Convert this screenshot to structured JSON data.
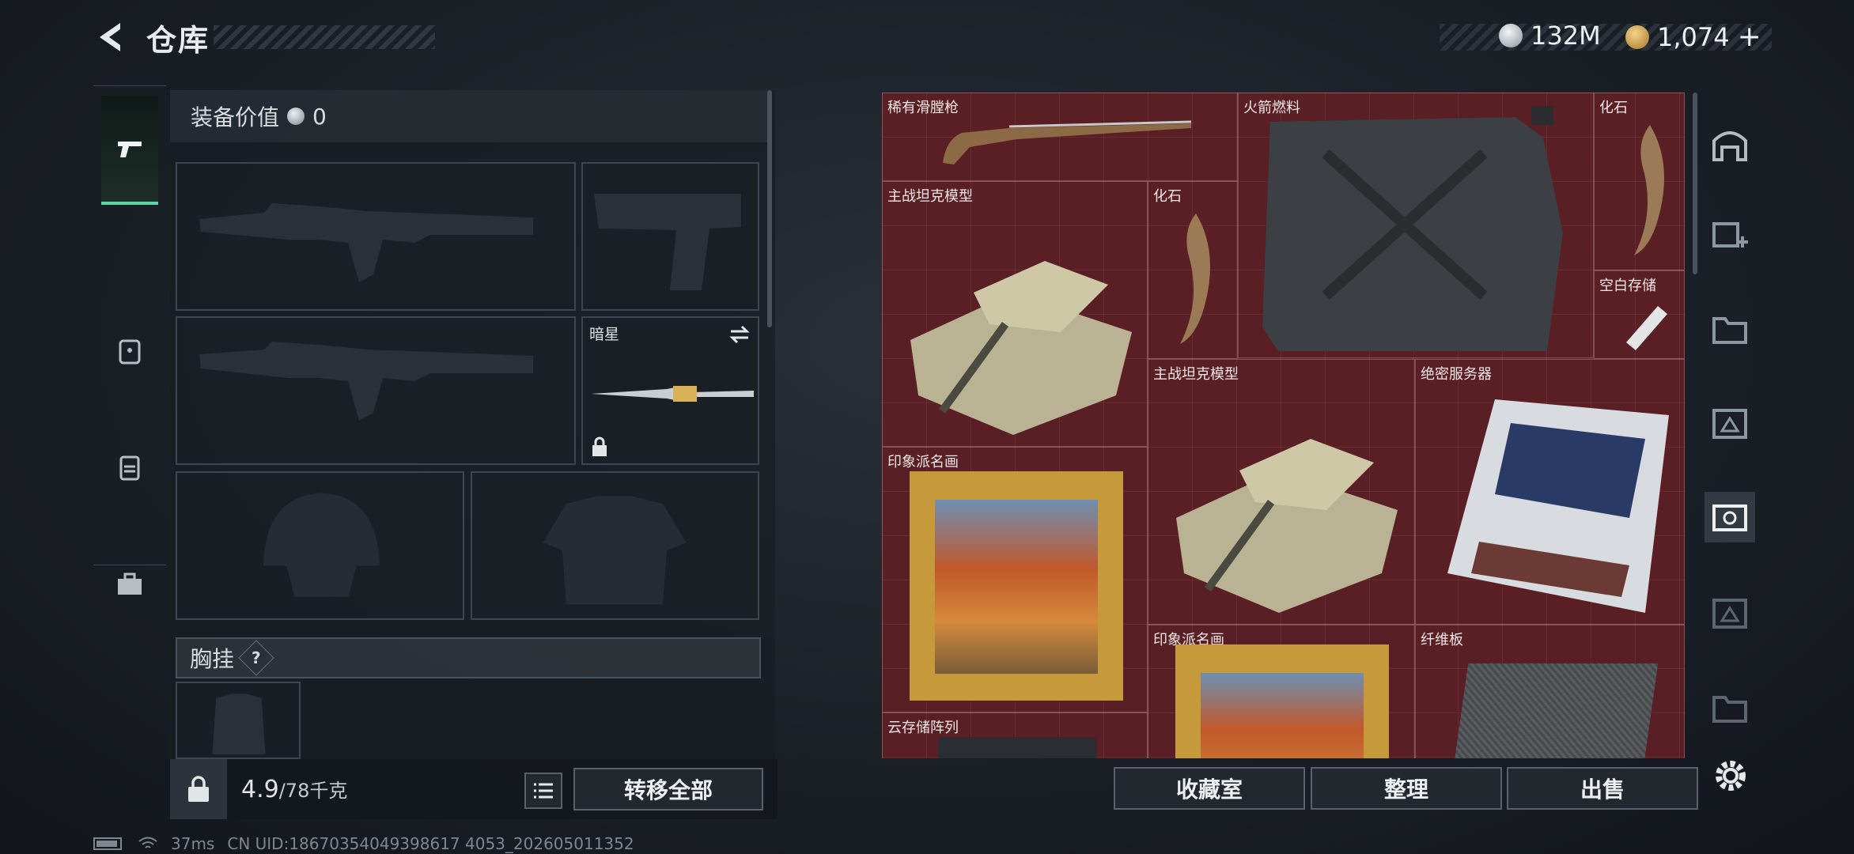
{
  "header": {
    "title": "仓库"
  },
  "currencies": [
    {
      "icon": "silver-coin-icon",
      "value": "132M"
    },
    {
      "icon": "gold-coin-icon",
      "value": "1,074"
    }
  ],
  "add_symbol": "+",
  "tabs": [
    {
      "icon": "pistol-icon",
      "active": true
    },
    {
      "icon": "medkit-icon",
      "active": false
    },
    {
      "icon": "backpack-icon",
      "active": false
    },
    {
      "icon": "toolbox-icon",
      "active": false
    }
  ],
  "equipment": {
    "value_label": "装备价值",
    "value": "0",
    "melee_name": "暗星",
    "chest_label": "胸挂",
    "chest_help": "?"
  },
  "bottom": {
    "weight": "4.9",
    "weight_max": "/78千克",
    "transfer_all": "转移全部"
  },
  "storage_items": [
    {
      "label": "稀有滑膛枪"
    },
    {
      "label": "火箭燃料"
    },
    {
      "label": "化石"
    },
    {
      "label": "主战坦克模型"
    },
    {
      "label": "化石"
    },
    {
      "label": "空白存储"
    },
    {
      "label": "主战坦克模型"
    },
    {
      "label": "绝密服务器"
    },
    {
      "label": "印象派名画"
    },
    {
      "label": "印象派名画"
    },
    {
      "label": "纤维板"
    },
    {
      "label": "云存储阵列"
    }
  ],
  "storage_buttons": {
    "collection": "收藏室",
    "arrange": "整理",
    "sell": "出售"
  },
  "side_icons": [
    "warehouse-icon",
    "add-storage-icon",
    "folder-storage-icon",
    "storage-box-icon",
    "active-storage-icon",
    "storage-box-icon",
    "folder-storage-icon"
  ],
  "status": {
    "ping": "37ms",
    "uid": "CN UID:18670354049398617 4053_202605011352"
  },
  "colors": {
    "accent": "#59d6a4",
    "storage_bg": "#5a1f24"
  }
}
